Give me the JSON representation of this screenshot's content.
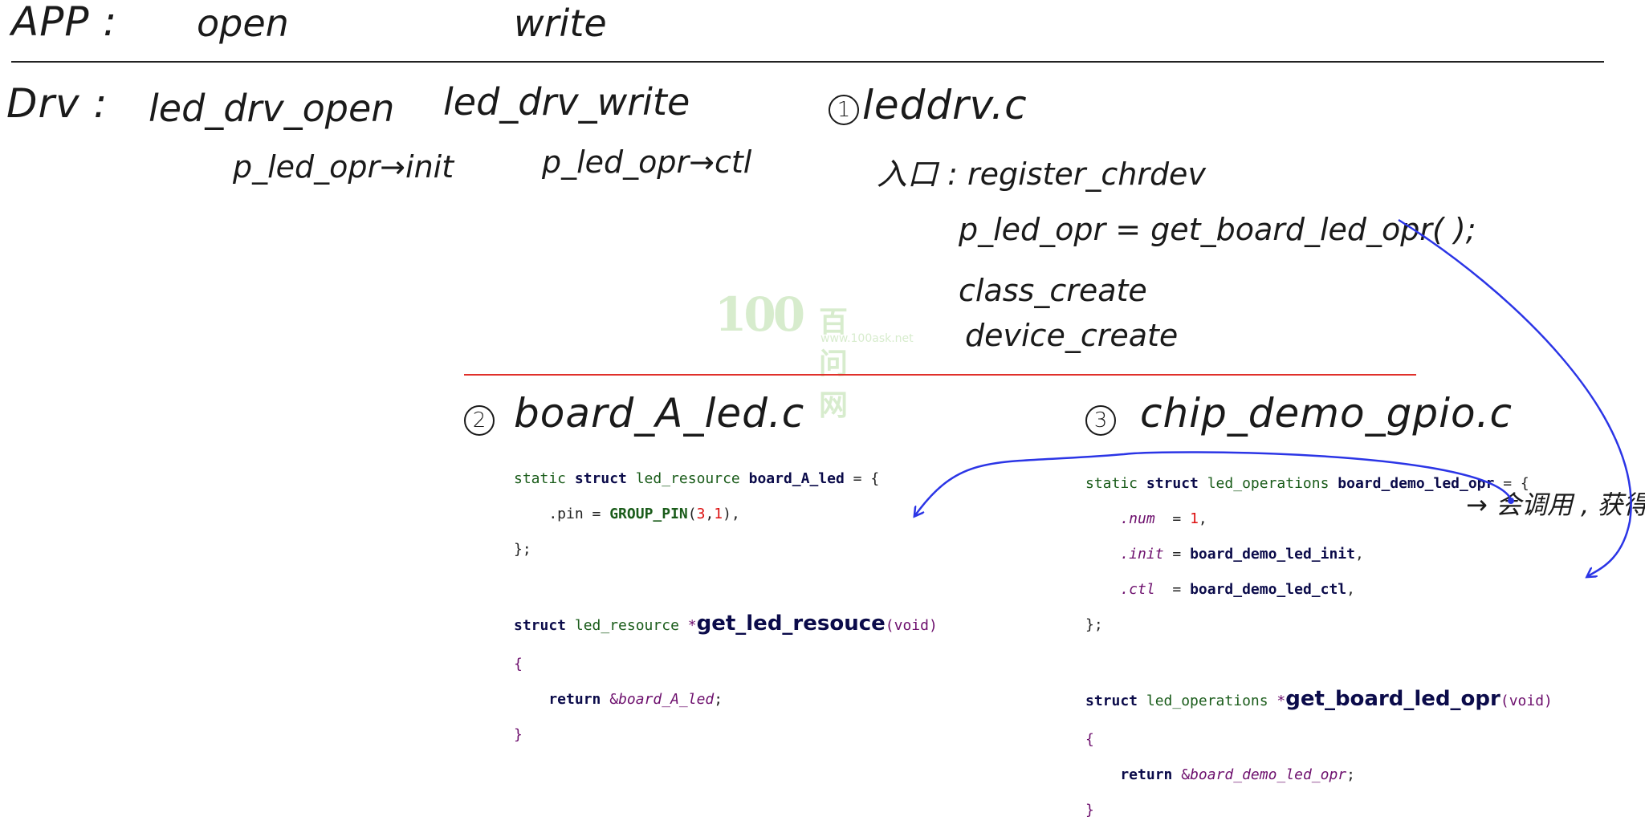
{
  "top": {
    "app_label": "APP :",
    "open_label": "open",
    "write_label": "write"
  },
  "drv": {
    "drv_label": "Drv :",
    "open_fn": "led_drv_open",
    "write_fn": "led_drv_write",
    "open_call": "p_led_opr→init",
    "write_call": "p_led_opr→ctl"
  },
  "leddrv": {
    "num": "1",
    "file": "leddrv.c",
    "entry_label": "入口 : register_chrdev",
    "line_get": "p_led_opr = get_board_led_opr( );",
    "line_class": "class_create",
    "line_device": "device_create"
  },
  "board": {
    "num": "2",
    "file": "board_A_led.c",
    "c1_static": "static ",
    "c1_struct": "struct ",
    "c1_type": "led_resource ",
    "c1_name": "board_A_led",
    "c1_eq": " = {",
    "c2_pin": "    .pin = ",
    "c2_macro": "GROUP_PIN",
    "c2_open": "(",
    "c2_a": "3",
    "c2_comma": ",",
    "c2_b": "1",
    "c2_close": "),",
    "c3": "};",
    "c5_struct": "struct ",
    "c5_type": "led_resource ",
    "c5_star": "*",
    "c5_fn": "get_led_resouce",
    "c5_args": "(void)",
    "c6": "{",
    "c7_ret": "    return ",
    "c7_amp": "&",
    "c7_ref": "board_A_led",
    "c7_semi": ";",
    "c8": "}"
  },
  "chip": {
    "num": "3",
    "file": "chip_demo_gpio.c",
    "k1_static": "static ",
    "k1_struct": "struct ",
    "k1_type": "led_operations ",
    "k1_name": "board_demo_led_opr",
    "k1_eq": " = {",
    "k2_mem": "    .num  ",
    "k2_eq": "= ",
    "k2_val": "1",
    "k2_c": ",",
    "k3_mem": "    .init",
    "k3_eq": " = ",
    "k3_val": "board_demo_led_init",
    "k3_c": ",",
    "k4_mem": "    .ctl ",
    "k4_eq": " = ",
    "k4_val": "board_demo_led_ctl",
    "k4_c": ",",
    "k5": "};",
    "k7_struct": "struct ",
    "k7_type": "led_operations ",
    "k7_star": "*",
    "k7_fn": "get_board_led_opr",
    "k7_args": "(void)",
    "k8": "{",
    "k9_ret": "    return ",
    "k9_amp": "&",
    "k9_ref": "board_demo_led_opr",
    "k9_semi": ";",
    "k10": "}",
    "note": "→ 会调用 , 获得引脚"
  },
  "watermark": {
    "logo": "100",
    "cn": "百问网",
    "url": "www.100ask.net"
  },
  "colors": {
    "divider_black": "#222222",
    "divider_red": "#e0302a",
    "annotation_blue": "#2b35e6",
    "keyword_green": "#1a5c1a",
    "identifier_navy": "#0b0b4a",
    "italic_purple": "#6d0f6d",
    "number_red": "#dd1111"
  }
}
